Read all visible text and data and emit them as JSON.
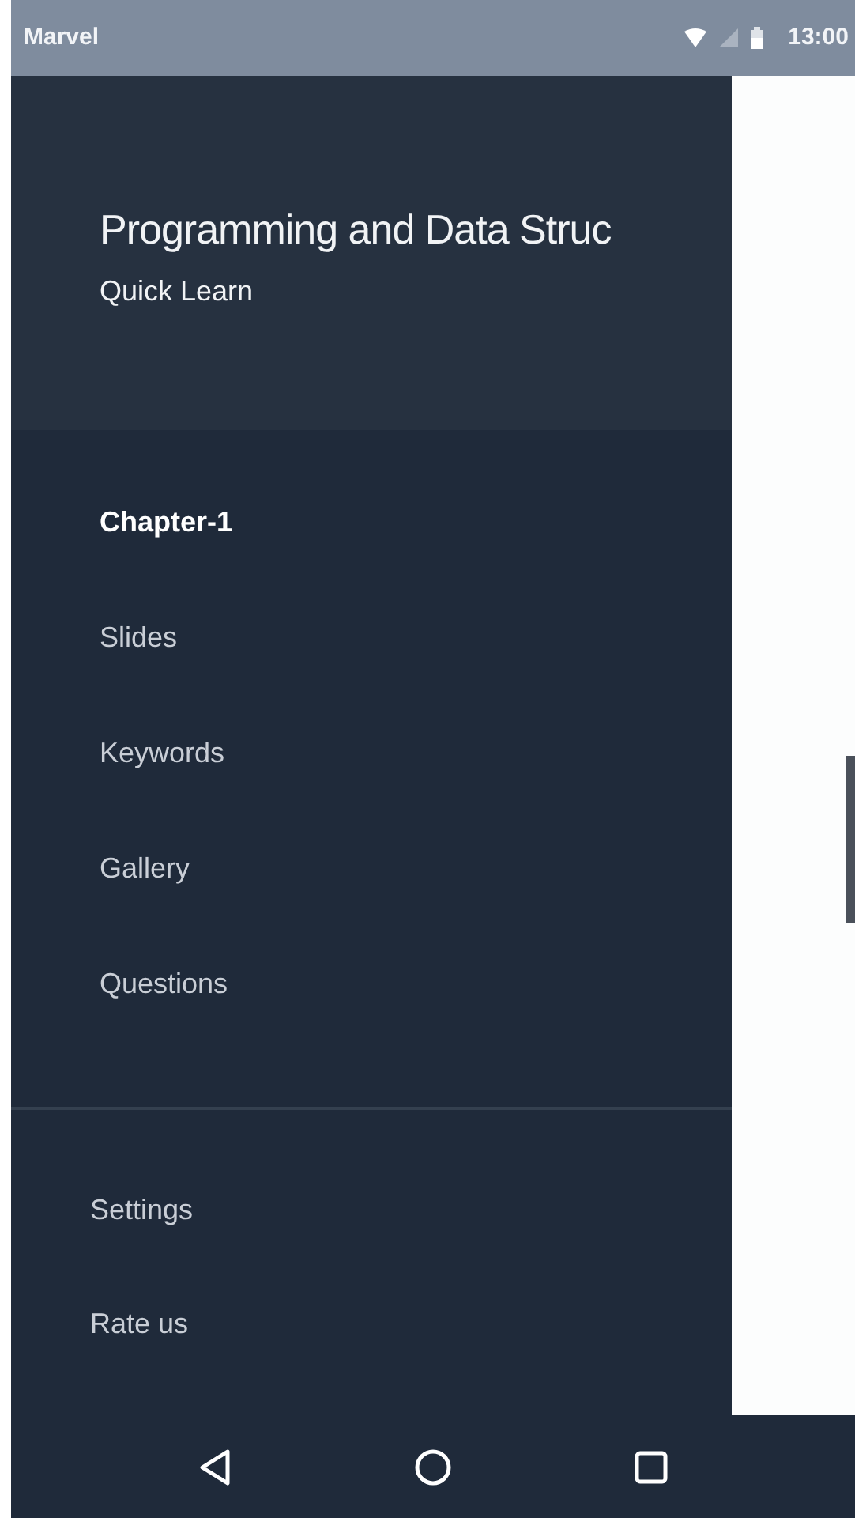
{
  "status_bar": {
    "app": "Marvel",
    "time": "13:00"
  },
  "drawer": {
    "title": "Programming and Data Struc",
    "subtitle": "Quick Learn",
    "items": [
      {
        "label": "Chapter-1",
        "selected": true
      },
      {
        "label": "Slides",
        "selected": false
      },
      {
        "label": "Keywords",
        "selected": false
      },
      {
        "label": "Gallery",
        "selected": false
      },
      {
        "label": "Questions",
        "selected": false
      }
    ],
    "footer_items": [
      {
        "label": "Settings"
      },
      {
        "label": "Rate us"
      }
    ]
  }
}
